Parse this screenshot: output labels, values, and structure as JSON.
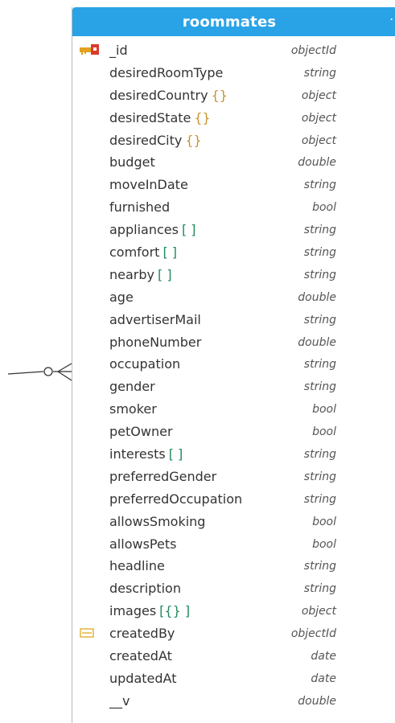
{
  "collection": {
    "title": "roommates",
    "menu_icon": "ellipsis-icon",
    "header_color": "#29a3e6"
  },
  "fields": [
    {
      "name": "_id",
      "suffix": "",
      "type": "objectId",
      "icon": "primary-key-icon"
    },
    {
      "name": "desiredRoomType",
      "suffix": "",
      "type": "string",
      "icon": ""
    },
    {
      "name": "desiredCountry",
      "suffix": "{}",
      "type": "object",
      "icon": ""
    },
    {
      "name": "desiredState",
      "suffix": "{}",
      "type": "object",
      "icon": ""
    },
    {
      "name": "desiredCity",
      "suffix": "{}",
      "type": "object",
      "icon": ""
    },
    {
      "name": "budget",
      "suffix": "",
      "type": "double",
      "icon": ""
    },
    {
      "name": "moveInDate",
      "suffix": "",
      "type": "string",
      "icon": ""
    },
    {
      "name": "furnished",
      "suffix": "",
      "type": "bool",
      "icon": ""
    },
    {
      "name": "appliances",
      "suffix": "[ ]",
      "type": "string",
      "icon": ""
    },
    {
      "name": "comfort",
      "suffix": "[ ]",
      "type": "string",
      "icon": ""
    },
    {
      "name": "nearby",
      "suffix": "[ ]",
      "type": "string",
      "icon": ""
    },
    {
      "name": "age",
      "suffix": "",
      "type": "double",
      "icon": ""
    },
    {
      "name": "advertiserMail",
      "suffix": "",
      "type": "string",
      "icon": ""
    },
    {
      "name": "phoneNumber",
      "suffix": "",
      "type": "double",
      "icon": ""
    },
    {
      "name": "occupation",
      "suffix": "",
      "type": "string",
      "icon": ""
    },
    {
      "name": "gender",
      "suffix": "",
      "type": "string",
      "icon": ""
    },
    {
      "name": "smoker",
      "suffix": "",
      "type": "bool",
      "icon": ""
    },
    {
      "name": "petOwner",
      "suffix": "",
      "type": "bool",
      "icon": ""
    },
    {
      "name": "interests",
      "suffix": "[ ]",
      "type": "string",
      "icon": ""
    },
    {
      "name": "preferredGender",
      "suffix": "",
      "type": "string",
      "icon": ""
    },
    {
      "name": "preferredOccupation",
      "suffix": "",
      "type": "string",
      "icon": ""
    },
    {
      "name": "allowsSmoking",
      "suffix": "",
      "type": "bool",
      "icon": ""
    },
    {
      "name": "allowsPets",
      "suffix": "",
      "type": "bool",
      "icon": ""
    },
    {
      "name": "headline",
      "suffix": "",
      "type": "string",
      "icon": ""
    },
    {
      "name": "description",
      "suffix": "",
      "type": "string",
      "icon": ""
    },
    {
      "name": "images",
      "suffix": "[{} ]",
      "type": "object",
      "icon": ""
    },
    {
      "name": "createdBy",
      "suffix": "",
      "type": "objectId",
      "icon": "foreign-key-icon"
    },
    {
      "name": "createdAt",
      "suffix": "",
      "type": "date",
      "icon": ""
    },
    {
      "name": "updatedAt",
      "suffix": "",
      "type": "date",
      "icon": ""
    },
    {
      "name": "__v",
      "suffix": "",
      "type": "double",
      "icon": ""
    }
  ],
  "relationship": {
    "icon": "zero-or-many-crowfoot-icon"
  }
}
